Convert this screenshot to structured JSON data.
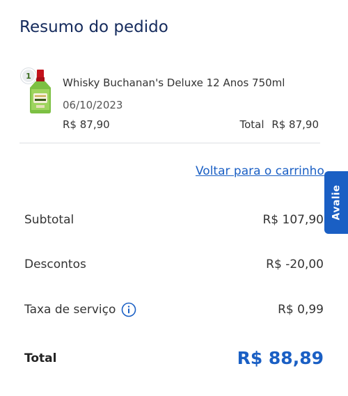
{
  "header": {
    "title": "Resumo do pedido"
  },
  "product": {
    "quantity": "1",
    "name": "Whisky Buchanan's Deluxe 12 Anos 750ml",
    "date": "06/10/2023",
    "price": "R$ 87,90",
    "total_label": "Total",
    "total_value": "R$ 87,90"
  },
  "actions": {
    "back_link": "Voltar para o carrinho"
  },
  "side_tab": {
    "label": "Avalie"
  },
  "summary": {
    "subtotal_label": "Subtotal",
    "subtotal_value": "R$ 107,90",
    "discount_label": "Descontos",
    "discount_value": "R$ -20,00",
    "service_fee_label": "Taxa de serviço",
    "service_fee_value": "R$ 0,99",
    "total_label": "Total",
    "total_value": "R$ 88,89"
  },
  "icons": {
    "info": "info-icon",
    "product_image": "bottle-image"
  },
  "colors": {
    "title": "#142a5c",
    "accent": "#1a5fc4",
    "divider": "#dcdfe3"
  }
}
